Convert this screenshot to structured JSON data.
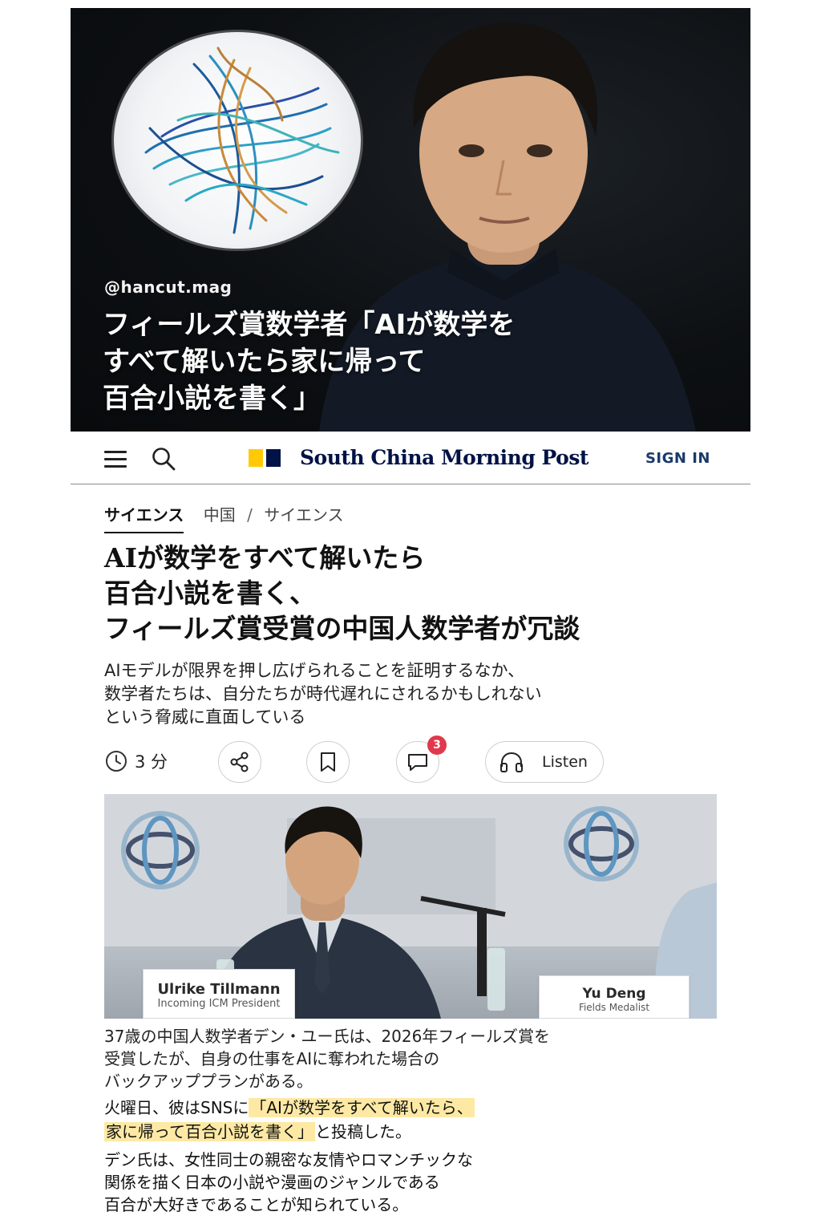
{
  "hero": {
    "handle": "@hancut.mag",
    "title_lines": [
      "フィールズ賞数学者「AIが数学を",
      "すべて解いたら家に帰って",
      "百合小説を書く」"
    ]
  },
  "nav": {
    "logo_text": "South China Morning Post",
    "sign_in": "SIGN IN",
    "icons": [
      "menu-icon",
      "search-icon"
    ],
    "logo_colors": [
      "#ffca05",
      "#001246"
    ]
  },
  "breadcrumb": {
    "active": "サイエンス",
    "path": [
      "中国",
      "サイエンス"
    ],
    "separator": "/"
  },
  "article": {
    "headline_lines": [
      "AIが数学をすべて解いたら",
      "百合小説を書く、",
      "フィールズ賞受賞の中国人数学者が冗談"
    ],
    "dek_lines": [
      "AIモデルが限界を押し広げられることを証明するなか、",
      "数学者たちは、自分たちが時代遅れにされるかもしれない",
      "という脅威に直面している"
    ]
  },
  "actions": {
    "read_time": "3 分",
    "comment_count": "3",
    "listen_label": "Listen",
    "icons": [
      "clock-icon",
      "share-icon",
      "bookmark-icon",
      "comment-icon",
      "headphones-icon"
    ],
    "badge_color": "#e0384c"
  },
  "photo": {
    "left_placard_name": "Ulrike Tillmann",
    "left_placard_role": "Incoming ICM President",
    "right_placard_name": "Yu Deng",
    "right_placard_role": "Fields Medalist"
  },
  "body": {
    "caption_lines": [
      "37歳の中国人数学者デン・ユー氏は、2026年フィールズ賞を",
      "受賞したが、自身の仕事をAIに奪われた場合の",
      "バックアッププランがある。"
    ],
    "para2_prefix": "火曜日、彼はSNSに",
    "para2_quote_line1": "「AIが数学をすべて解いたら、",
    "para2_quote_line2": "家に帰って百合小説を書く」",
    "para2_suffix": "と投稿した。",
    "para3_lines": [
      "デン氏は、女性同士の親密な友情やロマンチックな",
      "関係を描く日本の小説や漫画のジャンルである",
      "百合が大好きであることが知られている。"
    ],
    "highlight_color": "#fde9a4"
  }
}
